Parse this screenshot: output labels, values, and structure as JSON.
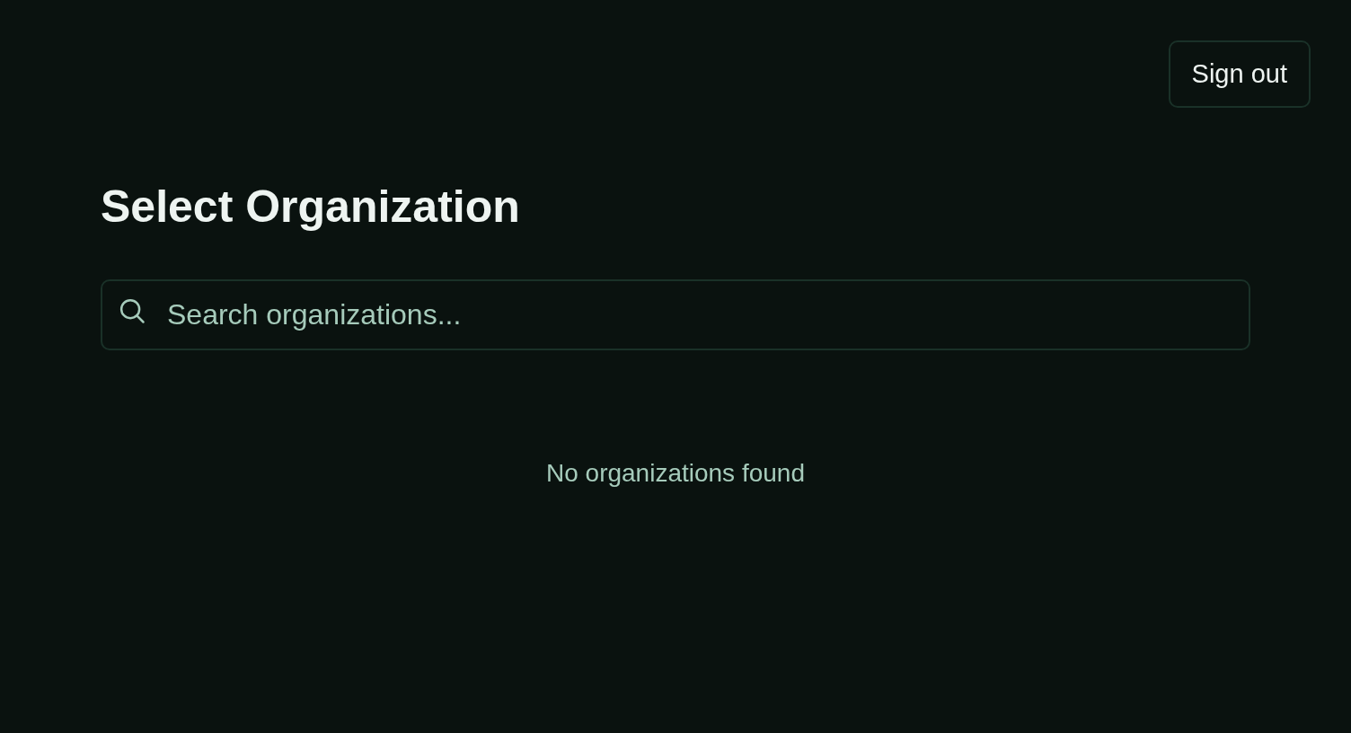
{
  "header": {
    "sign_out_button": "Sign out"
  },
  "title": "Select Organization",
  "search": {
    "placeholder": "Search organizations..."
  },
  "empty_message": "No organizations found"
}
